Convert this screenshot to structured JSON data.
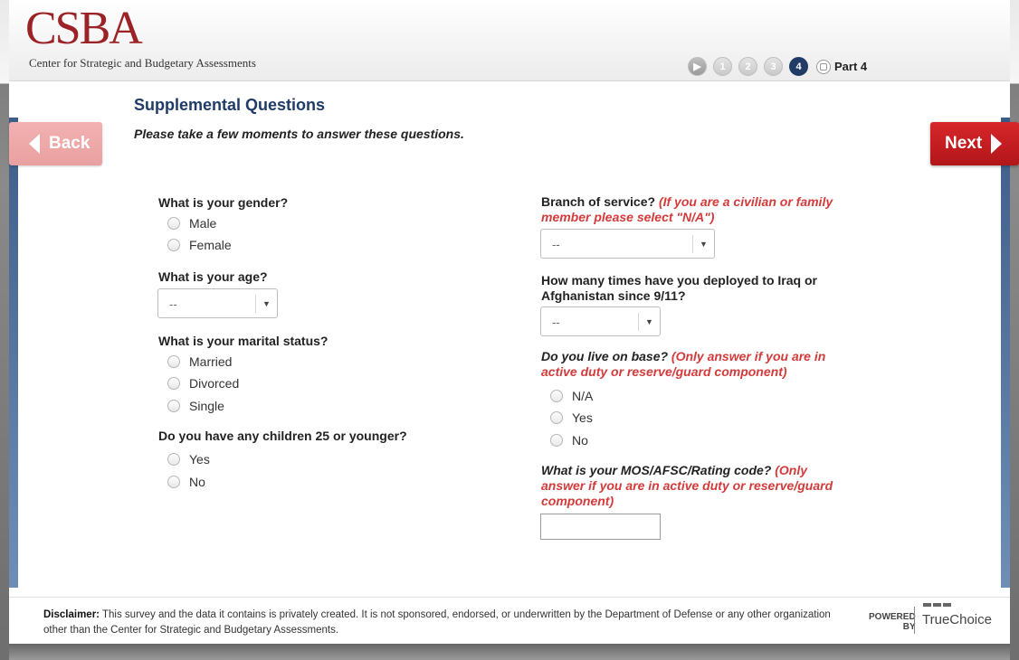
{
  "header": {
    "logo": "CSBA",
    "logo_subtitle": "Center for Strategic and Budgetary Assessments",
    "steps": [
      "",
      "1",
      "2",
      "3",
      "4"
    ],
    "active_step": "4",
    "part_label": "Part 4"
  },
  "nav": {
    "back_label": "Back",
    "next_label": "Next"
  },
  "page": {
    "title": "Supplemental Questions",
    "subtitle": "Please take a few moments to answer these questions."
  },
  "questions": {
    "gender": {
      "label": "What is your gender?",
      "options": [
        "Male",
        "Female"
      ]
    },
    "age": {
      "label": "What is your age?",
      "selected": "--"
    },
    "marital": {
      "label": "What is your marital status?",
      "options": [
        "Married",
        "Divorced",
        "Single"
      ]
    },
    "children": {
      "label": "Do you have any children 25 or younger?",
      "options": [
        "Yes",
        "No"
      ]
    },
    "branch": {
      "label": "Branch of service? ",
      "note": "(If you are a civilian or family member please select \"N/A\")",
      "selected": "--"
    },
    "deployed": {
      "label": "How many times have you deployed to Iraq or Afghanistan since 9/11?",
      "selected": "--"
    },
    "base": {
      "label": "Do you live on base? ",
      "note": "(Only answer if you are in active duty or reserve/guard component)",
      "options": [
        "N/A",
        "Yes",
        "No"
      ]
    },
    "mos": {
      "label": "What is your MOS/AFSC/Rating code? ",
      "note": "(Only answer if you are in active duty or reserve/guard component)",
      "value": ""
    }
  },
  "footer": {
    "disclaimer_label": "Disclaimer:",
    "disclaimer_text": " This survey and the data it contains is privately created. It is not sponsored, endorsed, or underwritten by the Department of Defense or any other organization other than the Center for Strategic and Budgetary Assessments.",
    "powered_line1": "POWERED",
    "powered_line2": "BY",
    "brand": "TrueChoice"
  },
  "colors": {
    "accent_navy": "#1f3b66",
    "brand_red": "#9b2226",
    "next_red": "#c41e22",
    "note_red": "#d33b3b"
  }
}
